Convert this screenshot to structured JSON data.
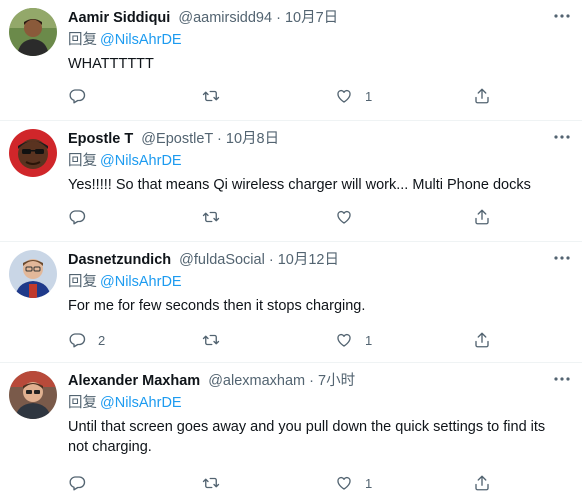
{
  "reply_prefix": "回复",
  "tweets": [
    {
      "name": "Aamir Siddiqui",
      "handle": "@aamirsidd94",
      "separator": "·",
      "time": "10月7日",
      "reply_to": "@NilsAhrDE",
      "text": "WHATTTTTT",
      "replies": "",
      "retweets": "",
      "likes": "1"
    },
    {
      "name": "Epostle T",
      "handle": "@EpostleT",
      "separator": "·",
      "time": "10月8日",
      "reply_to": "@NilsAhrDE",
      "text": "Yes!!!!! So that means Qi wireless charger will work... Multi Phone docks",
      "replies": "",
      "retweets": "",
      "likes": ""
    },
    {
      "name": "Dasnetzundich",
      "handle": "@fuldaSocial",
      "separator": "·",
      "time": "10月12日",
      "reply_to": "@NilsAhrDE",
      "text": "For me for few seconds then it stops charging.",
      "replies": "2",
      "retweets": "",
      "likes": "1"
    },
    {
      "name": "Alexander Maxham",
      "handle": "@alexmaxham",
      "separator": "·",
      "time": "7小时",
      "reply_to": "@NilsAhrDE",
      "text": "Until that screen goes away and you pull down the quick settings to find its not charging.",
      "replies": "",
      "retweets": "",
      "likes": "1"
    }
  ],
  "icons": {
    "reply": "reply-icon",
    "retweet": "retweet-icon",
    "like": "heart-icon",
    "share": "share-icon",
    "more": "more-icon"
  },
  "colors": {
    "text": "#0f1419",
    "secondary": "#536471",
    "link": "#1d9bf0",
    "divider": "#eff3f4"
  }
}
